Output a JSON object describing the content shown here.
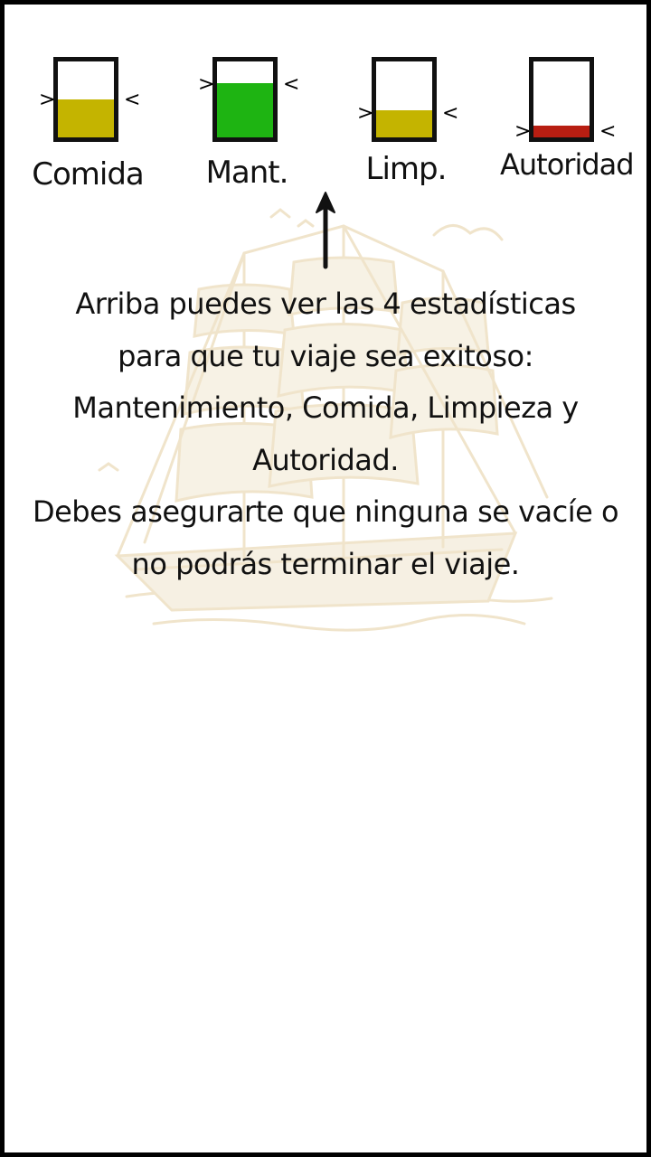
{
  "meters": [
    {
      "label": "Comida",
      "level": 0.5,
      "color": "#c4b400",
      "left_marker": ">",
      "right_marker": "<"
    },
    {
      "label": "Mant.",
      "level": 0.72,
      "color": "#1eb412",
      "left_marker": ">",
      "right_marker": "<"
    },
    {
      "label": "Limp.",
      "level": 0.36,
      "color": "#c4b400",
      "left_marker": ">",
      "right_marker": "<"
    },
    {
      "label": "Autoridad",
      "level": 0.16,
      "color": "#b81e12",
      "left_marker": ">",
      "right_marker": "<"
    }
  ],
  "tutorial": {
    "paragraph1": "Arriba puedes ver las 4 estadísticas para que tu viaje sea exitoso: Mantenimiento, Comida, Limpieza y Autoridad.",
    "paragraph2": "Debes asegurarte que ninguna se vacíe o no podrás terminar el viaje."
  },
  "icons": {
    "pointer": "up-arrow-icon",
    "background": "sailing-ship-illustration"
  }
}
